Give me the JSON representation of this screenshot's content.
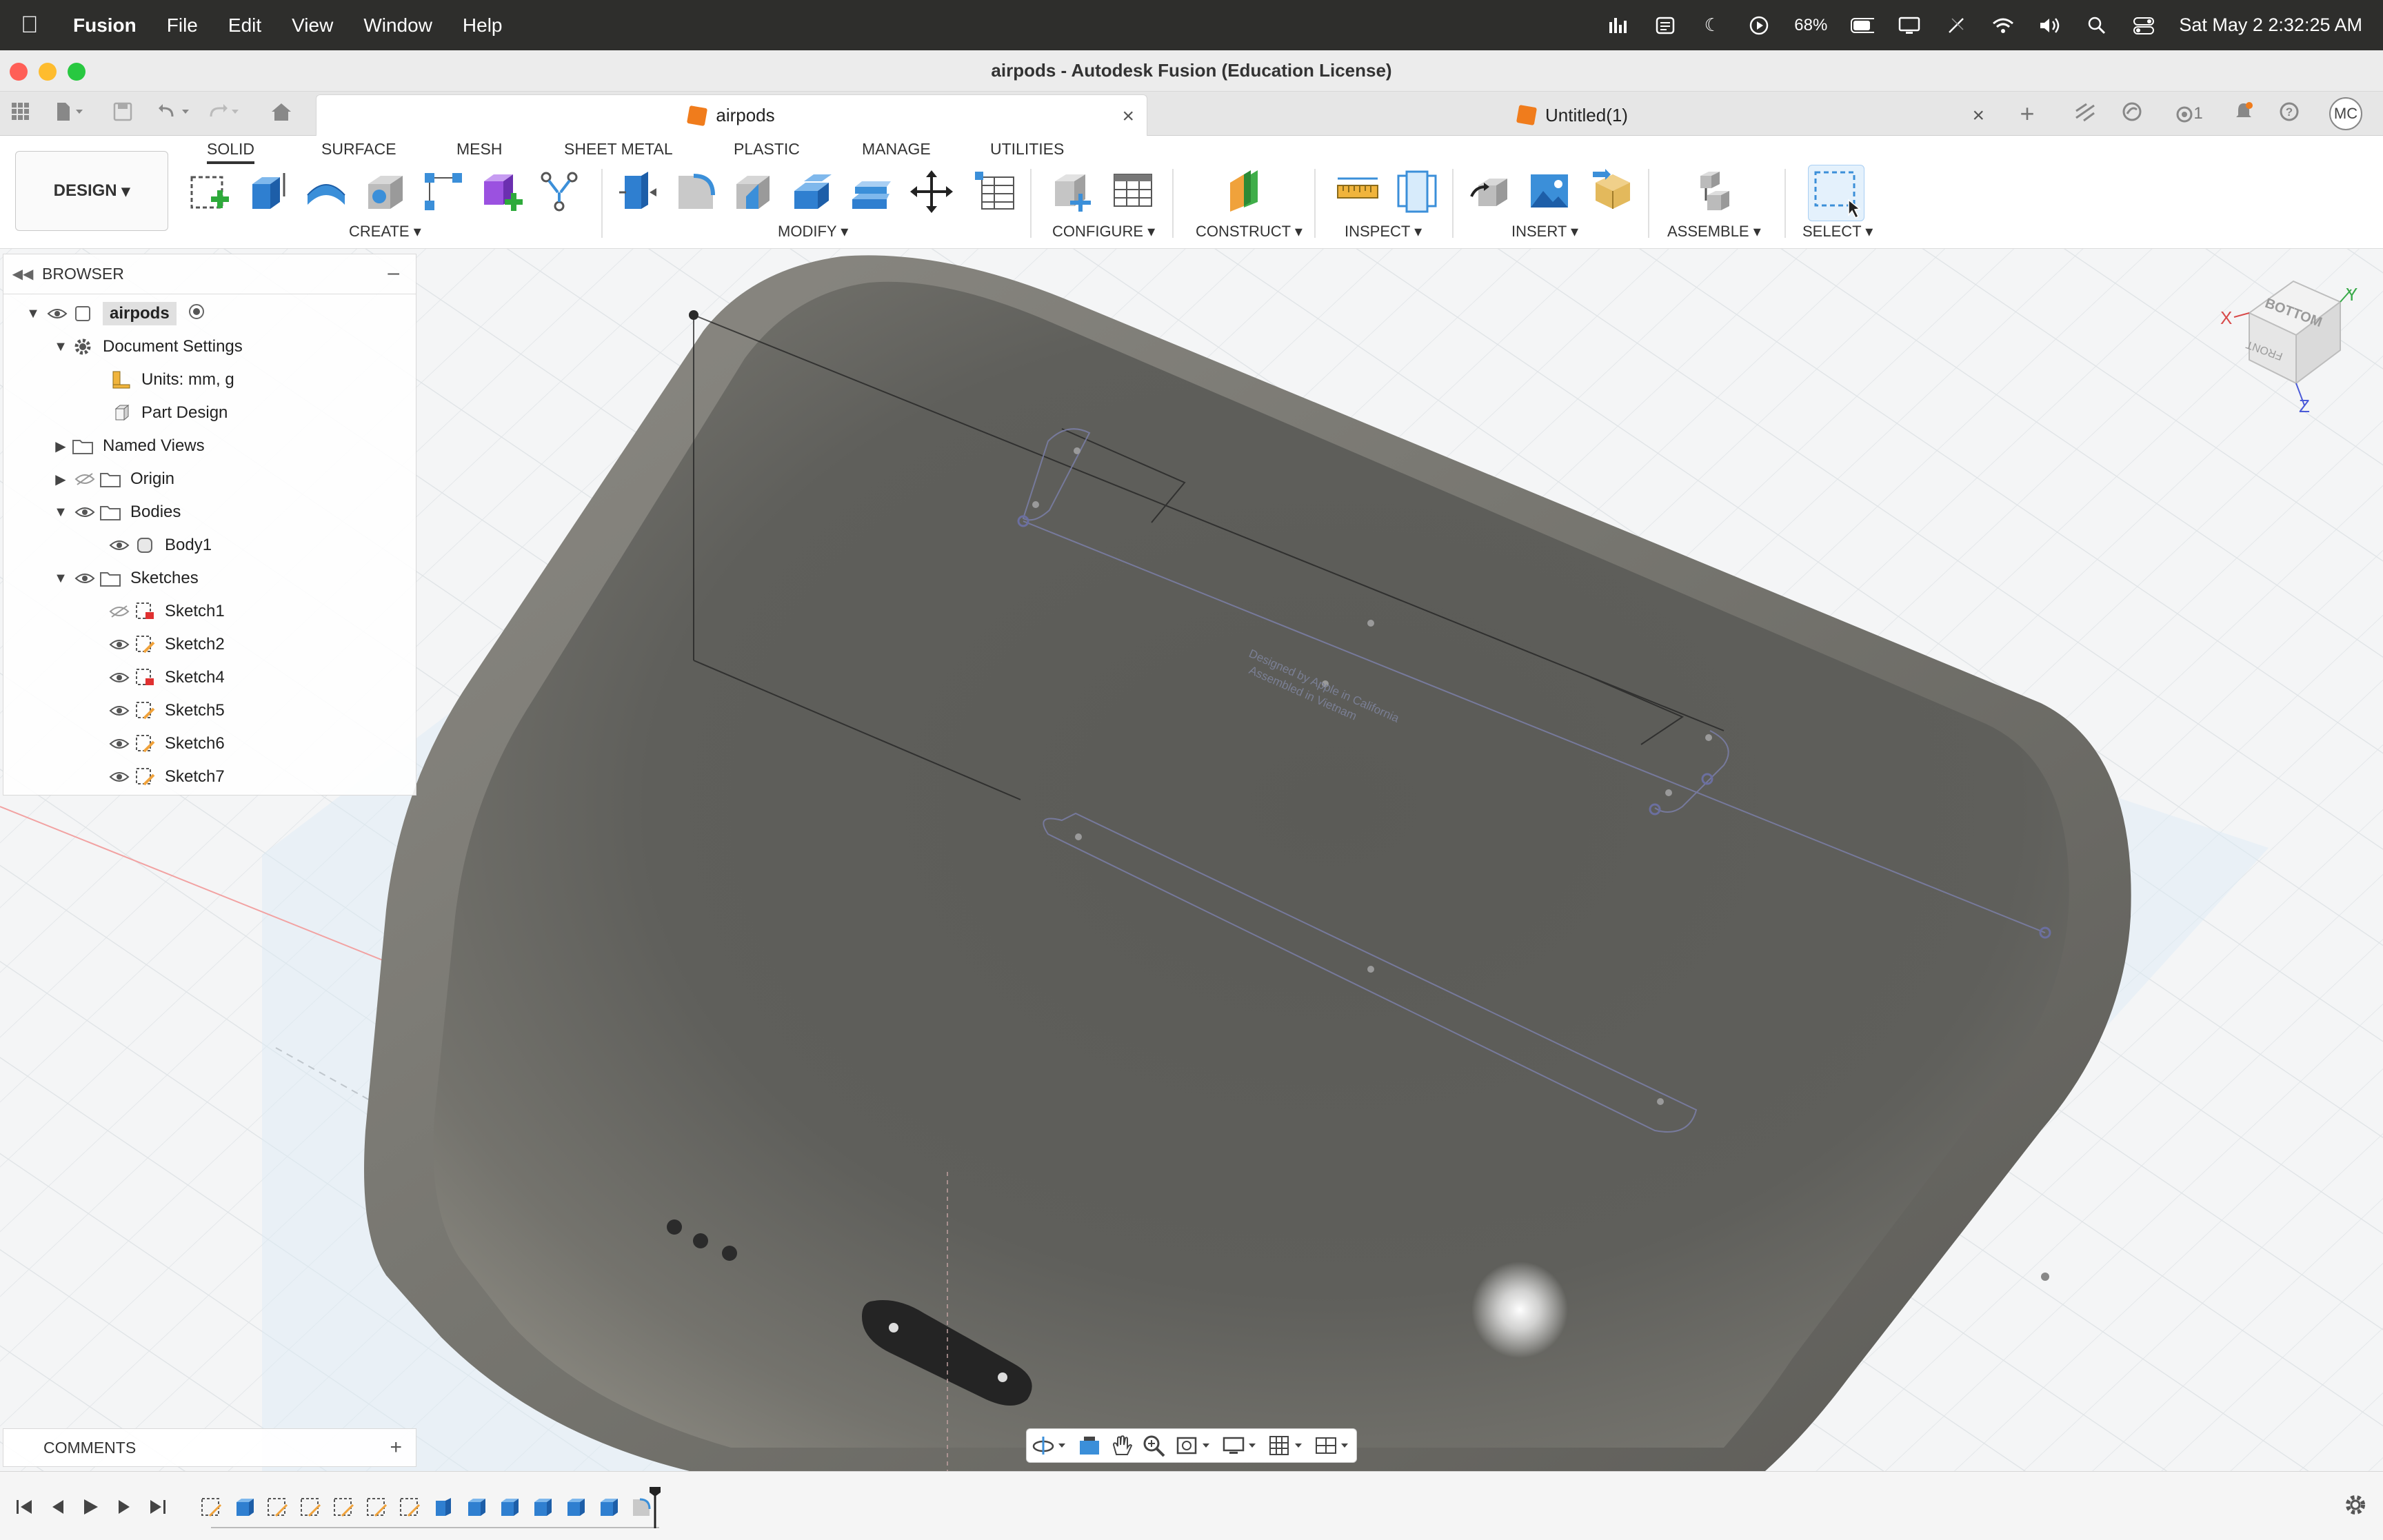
{
  "menubar": {
    "app_name": "Fusion",
    "items": [
      "File",
      "Edit",
      "View",
      "Window",
      "Help"
    ],
    "battery": "68%",
    "clock": "Sat May 2  2:32:25 AM"
  },
  "window": {
    "title": "airpods - Autodesk Fusion (Education License)"
  },
  "tabs": [
    {
      "label": "airpods",
      "active": true
    },
    {
      "label": "Untitled(1)",
      "active": false
    }
  ],
  "tabrow_right": {
    "jobs_count": "1",
    "user_initials": "MC"
  },
  "toolbar": {
    "workspace": "DESIGN",
    "tabs": [
      "SOLID",
      "SURFACE",
      "MESH",
      "SHEET METAL",
      "PLASTIC",
      "MANAGE",
      "UTILITIES"
    ],
    "groups": {
      "create": "CREATE",
      "modify": "MODIFY",
      "configure": "CONFIGURE",
      "construct": "CONSTRUCT",
      "inspect": "INSPECT",
      "insert": "INSERT",
      "assemble": "ASSEMBLE",
      "select": "SELECT"
    }
  },
  "browser": {
    "title": "BROWSER",
    "tree": {
      "root": "airpods",
      "document_settings": "Document Settings",
      "units": "Units: mm, g",
      "part_design": "Part Design",
      "named_views": "Named Views",
      "origin": "Origin",
      "bodies": "Bodies",
      "body1": "Body1",
      "sketches": "Sketches",
      "sketch_items": [
        "Sketch1",
        "Sketch2",
        "Sketch4",
        "Sketch5",
        "Sketch6",
        "Sketch7"
      ]
    }
  },
  "comments": {
    "title": "COMMENTS"
  },
  "viewcube": {
    "face_top": "BOTTOM",
    "face_side": "FRONT",
    "axis_x": "X",
    "axis_y": "Y",
    "axis_z": "Z"
  },
  "model": {
    "engraving_line1": "Designed by Apple in California",
    "engraving_line2": "Assembled in Vietnam"
  },
  "colors": {
    "accent": "#0696d7",
    "tool_blue": "#3b8fd9",
    "body_gray": "#6e6e68",
    "menubar": "#2e2e2c"
  }
}
